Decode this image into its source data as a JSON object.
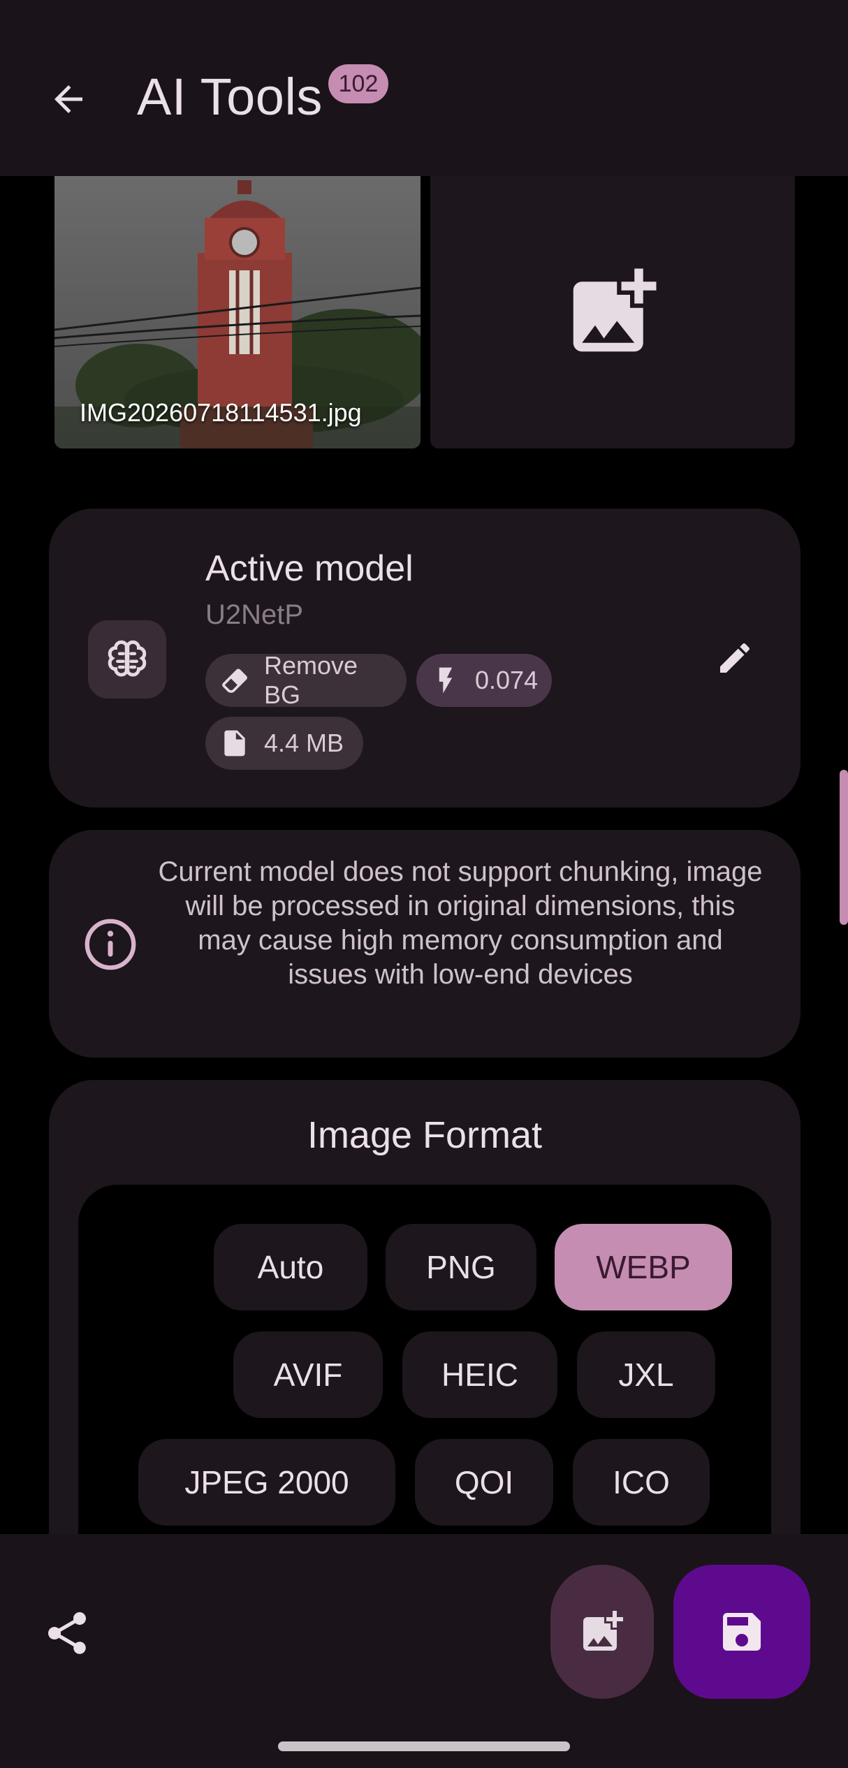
{
  "header": {
    "title": "AI Tools",
    "badge": "102",
    "back_icon": "arrow-left-icon"
  },
  "images": {
    "selected_file": "IMG20260718114531.jpg",
    "add_icon": "add-photo-icon"
  },
  "model": {
    "title": "Active model",
    "name": "U2NetP",
    "chips": {
      "task": "Remove BG",
      "speed": "0.074",
      "size": "4.4 MB"
    },
    "icons": [
      "brain-icon",
      "eraser-icon",
      "bolt-icon",
      "file-icon",
      "pencil-icon"
    ]
  },
  "info": {
    "text": "Current model does not support chunking, image will be processed in original dimensions, this may cause high memory consumption and issues with low-end devices"
  },
  "format": {
    "title": "Image Format",
    "options": [
      "Auto",
      "PNG",
      "WEBP",
      "AVIF",
      "HEIC",
      "JXL",
      "JPEG 2000",
      "QOI",
      "ICO"
    ],
    "selected": "WEBP"
  },
  "bottom": {
    "share_icon": "share-icon",
    "add_icon": "add-photo-icon",
    "save_icon": "save-icon"
  },
  "colors": {
    "accent": "#c58db1",
    "save_fab": "#5e0a8e",
    "surface": "#1d161c",
    "bar": "#1a1319"
  }
}
